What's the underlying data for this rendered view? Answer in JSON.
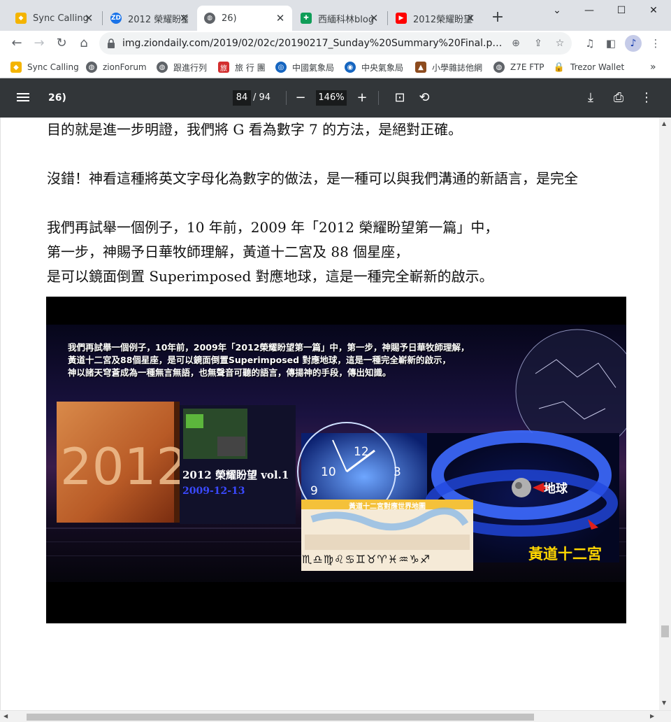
{
  "tabs": [
    {
      "title": "Sync Calling",
      "favicon_color": "#f4b400",
      "active": false
    },
    {
      "title": "2012 榮耀盼望",
      "favicon_color": "#1a73e8",
      "favicon_text": "ZD",
      "active": false
    },
    {
      "title": "26)",
      "favicon_color": "#5f6368",
      "active": true
    },
    {
      "title": "西緬科林blog",
      "favicon_color": "#0f9d58",
      "active": false
    },
    {
      "title": "2012榮耀盼望",
      "favicon_color": "#ff0000",
      "active": false
    }
  ],
  "new_tab_label": "+",
  "address_bar": {
    "url": "img.ziondaily.com/2019/02/02c/20190217_Sunday%20Summary%20Final.pdf?1..."
  },
  "bookmarks": [
    {
      "label": "Sync Calling",
      "icon": "sync-calling-icon"
    },
    {
      "label": "zionForum",
      "icon": "globe-icon"
    },
    {
      "label": "跟進行列",
      "icon": "globe-icon"
    },
    {
      "label": "旅 行 團",
      "icon": "travel-icon"
    },
    {
      "label": "中國氣象局",
      "icon": "weather-icon"
    },
    {
      "label": "中央氣象局",
      "icon": "weather-icon"
    },
    {
      "label": "小學雜誌他網",
      "icon": "magazine-icon"
    },
    {
      "label": "Z7E FTP",
      "icon": "globe-icon"
    },
    {
      "label": "Trezor Wallet",
      "icon": "lock-icon"
    }
  ],
  "bookmarks_overflow": "»",
  "pdf": {
    "title": "26)",
    "current_page": "84",
    "separator": "/",
    "total_pages": "94",
    "zoom": "146%"
  },
  "content": {
    "para1": "目的就是進一步明證，我們將 G 看為數字 7 的方法，是絕對正確。",
    "para2": "沒錯！神看這種將英文字母化為數字的做法，是一種可以與我們溝通的新語言，是完全",
    "para3_line1": "我們再試舉一個例子，10 年前，2009 年「2012 榮耀盼望第一篇」中，",
    "para3_line2": "第一步，神賜予日華牧師理解，黃道十二宮及 88 個星座，",
    "para3_line3": "是可以鏡面倒置 Superimposed 對應地球，這是一種完全嶄新的啟示。"
  },
  "slide": {
    "caption_line1": "我們再試舉一個例子，10年前，2009年「2012榮耀盼望第一篇」中，第一步，神賜予日華牧師理解，",
    "caption_line2": "黃道十二宮及88個星座，是可以鏡面倒置Superimposed 對應地球，這是一種完全嶄新的啟示，",
    "caption_line3": "神以諸天穹蒼成為一種無言無語，也無聲音可聽的語言，傳揚神的手段，傳出知識。",
    "book_year": "2012",
    "series_title": "2012 榮耀盼望 vol.1",
    "series_date": "2009-12-13",
    "map_title": "黃道十二宮對應世界地圖",
    "zodiac_symbols": "♏♎♍♌♋♊♉♈♓♒♑♐",
    "earth_label": "地球",
    "zodiac_label": "黃道十二宮",
    "clock_numbers": [
      "12",
      "10",
      "9",
      "3"
    ]
  },
  "colors": {
    "tabstrip_bg": "#dee1e6",
    "pdf_toolbar_bg": "#323639",
    "zodiac_label": "#ffd600",
    "date_text": "#3a49ff",
    "arrow_red": "#e0201b"
  }
}
